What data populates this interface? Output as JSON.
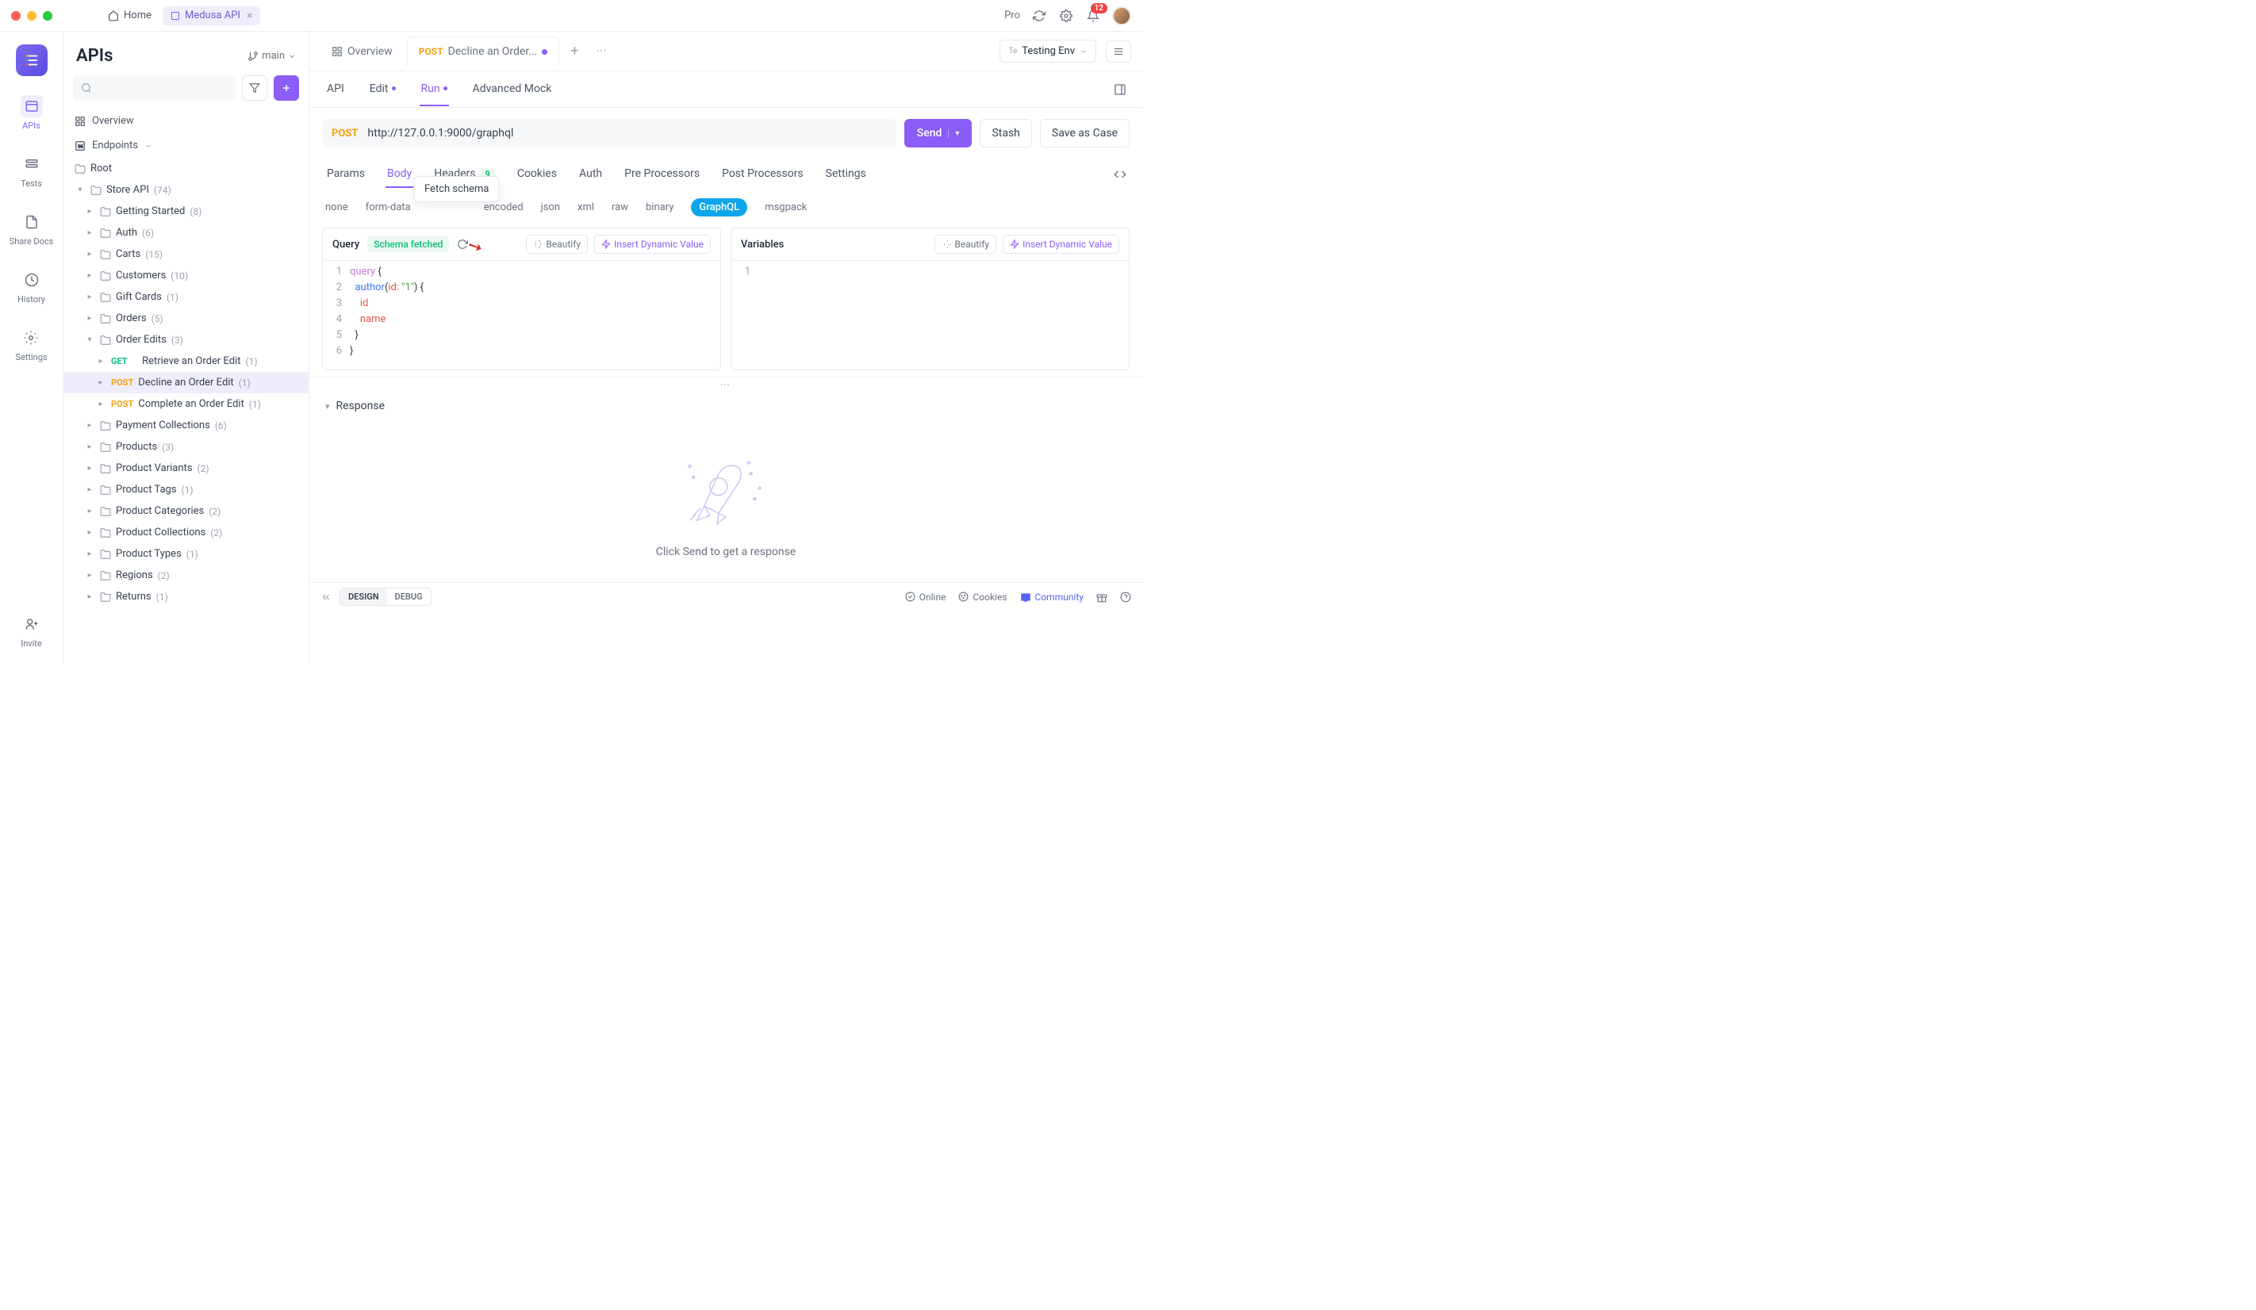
{
  "topbar": {
    "home_label": "Home",
    "active_tab_label": "Medusa API",
    "pro_label": "Pro",
    "notification_count": "12"
  },
  "rail": {
    "apis": "APIs",
    "tests": "Tests",
    "share": "Share Docs",
    "history": "History",
    "settings": "Settings",
    "invite": "Invite"
  },
  "sidebar": {
    "title": "APIs",
    "branch": "main",
    "overview": "Overview",
    "endpoints": "Endpoints",
    "root": "Root",
    "items": [
      {
        "label": "Store API",
        "count": "(74)"
      },
      {
        "label": "Getting Started",
        "count": "(8)"
      },
      {
        "label": "Auth",
        "count": "(6)"
      },
      {
        "label": "Carts",
        "count": "(15)"
      },
      {
        "label": "Customers",
        "count": "(10)"
      },
      {
        "label": "Gift Cards",
        "count": "(1)"
      },
      {
        "label": "Orders",
        "count": "(5)"
      },
      {
        "label": "Order Edits",
        "count": "(3)"
      },
      {
        "label": "Retrieve an Order Edit",
        "count": "(1)",
        "method": "GET"
      },
      {
        "label": "Decline an Order Edit",
        "count": "(1)",
        "method": "POST"
      },
      {
        "label": "Complete an Order Edit",
        "count": "(1)",
        "method": "POST"
      },
      {
        "label": "Payment Collections",
        "count": "(6)"
      },
      {
        "label": "Products",
        "count": "(3)"
      },
      {
        "label": "Product Variants",
        "count": "(2)"
      },
      {
        "label": "Product Tags",
        "count": "(1)"
      },
      {
        "label": "Product Categories",
        "count": "(2)"
      },
      {
        "label": "Product Collections",
        "count": "(2)"
      },
      {
        "label": "Product Types",
        "count": "(1)"
      },
      {
        "label": "Regions",
        "count": "(2)"
      },
      {
        "label": "Returns",
        "count": "(1)"
      }
    ]
  },
  "content": {
    "tab_overview": "Overview",
    "tab_active_method": "POST",
    "tab_active_label": "Decline an Order...",
    "env_tag": "Te",
    "env_name": "Testing Env",
    "subtabs": {
      "api": "API",
      "edit": "Edit",
      "run": "Run",
      "mock": "Advanced Mock"
    },
    "url_method": "POST",
    "url": "http://127.0.0.1:9000/graphql",
    "send": "Send",
    "stash": "Stash",
    "save_case": "Save as Case",
    "req_tabs": {
      "params": "Params",
      "body": "Body",
      "headers": "Headers",
      "headers_count": "9",
      "cookies": "Cookies",
      "auth": "Auth",
      "pre": "Pre Processors",
      "post": "Post Processors",
      "settings": "Settings"
    },
    "body_types": {
      "none": "none",
      "form": "form-data",
      "encoded": "encoded",
      "json": "json",
      "xml": "xml",
      "raw": "raw",
      "binary": "binary",
      "graphql": "GraphQL",
      "msgpack": "msgpack"
    },
    "tooltip": "Fetch schema",
    "query_label": "Query",
    "schema_status": "Schema fetched",
    "beautify": "Beautify",
    "insert_dynamic": "Insert Dynamic Value",
    "variables_label": "Variables",
    "code_lines": [
      "1",
      "2",
      "3",
      "4",
      "5",
      "6"
    ],
    "code_query": "query",
    "code_author": "author",
    "code_id_key": "id:",
    "code_id_val": "\"1\"",
    "code_field_id": "id",
    "code_field_name": "name",
    "vars_lines": [
      "1"
    ],
    "response_label": "Response",
    "empty_text": "Click Send to get a response"
  },
  "footer": {
    "design": "DESIGN",
    "debug": "DEBUG",
    "online": "Online",
    "cookies": "Cookies",
    "community": "Community"
  }
}
